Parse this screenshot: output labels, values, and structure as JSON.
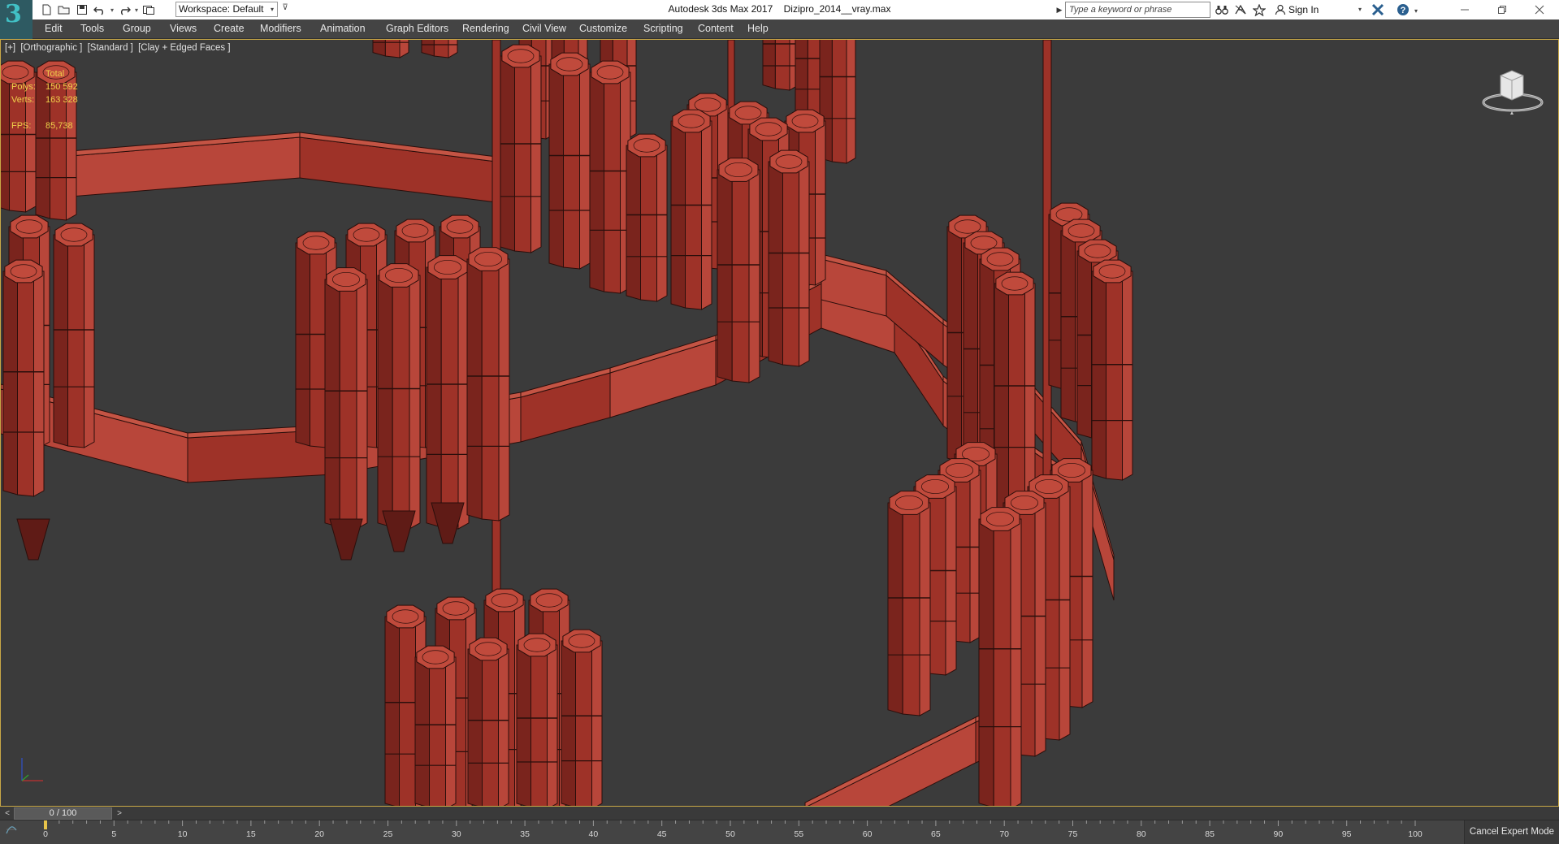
{
  "titlebar": {
    "app_name": "Autodesk 3ds Max 2017",
    "file_name": "Dizipro_2014__vray.max",
    "workspace_label": "Workspace: Default",
    "search_placeholder": "Type a keyword or phrase",
    "sign_in_label": "Sign In",
    "icons": [
      "new-file-icon",
      "open-file-icon",
      "save-icon",
      "undo-icon",
      "redo-icon",
      "project-folder-icon",
      "binoculars-icon",
      "communication-center-icon",
      "favorites-star-icon",
      "user-icon",
      "autodesk-exchange-icon",
      "help-icon",
      "minimize-icon",
      "restore-icon",
      "close-icon"
    ]
  },
  "menu": {
    "items": [
      "Edit",
      "Tools",
      "Group",
      "Views",
      "Create",
      "Modifiers",
      "Animation",
      "Graph Editors",
      "Rendering",
      "Civil View",
      "Customize",
      "Scripting",
      "Content",
      "Help"
    ]
  },
  "viewport": {
    "labels": [
      "[+]",
      "[Orthographic ]",
      "[Standard ]",
      "[Clay + Edged Faces ]"
    ],
    "stats": {
      "header": "Total",
      "polys_label": "Polys:",
      "polys_value": "150 592",
      "verts_label": "Verts:",
      "verts_value": "163 328",
      "fps_label": "FPS:",
      "fps_value": "85,738"
    },
    "model_color": "#9e3228",
    "background_color": "#3b3b3b",
    "active_border_color": "#c8a846"
  },
  "timeline": {
    "slider_value": "0 / 100",
    "prev_label": "<",
    "next_label": ">",
    "tick_labels": [
      "0",
      "5",
      "10",
      "15",
      "20",
      "25",
      "30",
      "35",
      "40",
      "45",
      "50",
      "55",
      "60",
      "65",
      "70",
      "75",
      "80",
      "85",
      "90",
      "95",
      "100"
    ],
    "current_frame": 0,
    "total_frames": 100,
    "expert_mode_label": "Cancel Expert Mode"
  }
}
